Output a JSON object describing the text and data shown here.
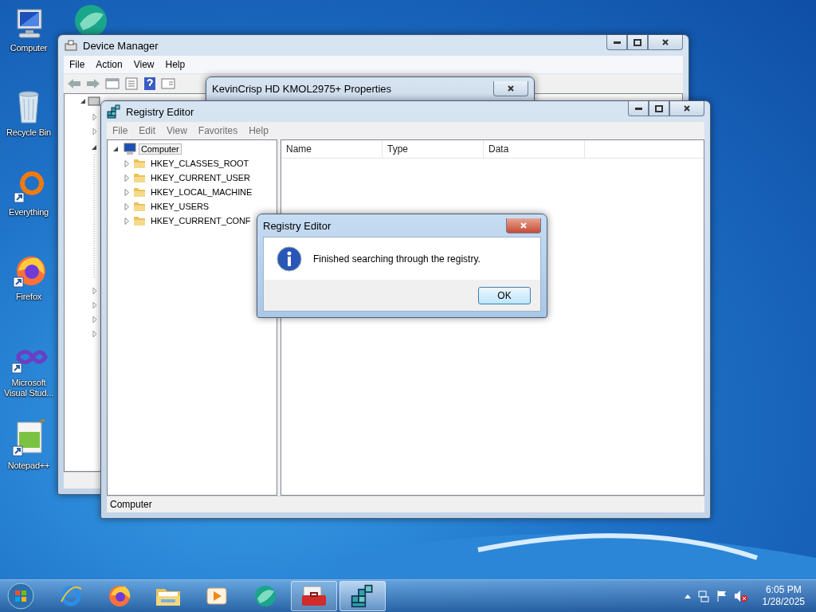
{
  "desktop": {
    "icons": [
      {
        "kind": "computer",
        "label": "Computer"
      },
      {
        "kind": "app"
      },
      {
        "kind": "recycle",
        "label": "Recycle Bin"
      },
      {
        "kind": "everything",
        "label": "Everything"
      },
      {
        "kind": "firefox",
        "label": "Firefox"
      },
      {
        "kind": "visualstudio",
        "label": "Microsoft Visual Stud..."
      },
      {
        "kind": "notepad",
        "label": "Notepad++"
      }
    ]
  },
  "device_manager": {
    "title": "Device Manager",
    "menu": [
      "File",
      "Action",
      "View",
      "Help"
    ]
  },
  "properties_window": {
    "title": "KevinCrisp HD KMOL2975+ Properties"
  },
  "registry_editor": {
    "title": "Registry Editor",
    "menu": [
      "File",
      "Edit",
      "View",
      "Favorites",
      "Help"
    ],
    "tree": [
      {
        "label": "Computer",
        "expanded": true,
        "selected": true,
        "children": [
          {
            "label": "HKEY_CLASSES_ROOT",
            "expanded": false,
            "selected": false
          },
          {
            "label": "HKEY_CURRENT_USER",
            "expanded": false,
            "selected": false
          },
          {
            "label": "HKEY_LOCAL_MACHINE",
            "expanded": false,
            "selected": false
          },
          {
            "label": "HKEY_USERS",
            "expanded": false,
            "selected": false
          },
          {
            "label": "HKEY_CURRENT_CONF",
            "expanded": false,
            "selected": false
          }
        ]
      }
    ],
    "columns": [
      "Name",
      "Type",
      "Data"
    ],
    "status_bar": "Computer"
  },
  "dialog": {
    "title": "Registry Editor",
    "message": "Finished searching through the registry.",
    "button": "OK"
  },
  "taskbar": {
    "items": [
      {
        "kind": "ie",
        "selected": false
      },
      {
        "kind": "firefox",
        "selected": false
      },
      {
        "kind": "explorer",
        "selected": false
      },
      {
        "kind": "media",
        "selected": false
      },
      {
        "kind": "app",
        "selected": false
      },
      {
        "kind": "toolbox",
        "selected": false
      },
      {
        "kind": "registry",
        "selected": true
      }
    ],
    "time": "6:05 PM",
    "date": "1/28/2025"
  }
}
